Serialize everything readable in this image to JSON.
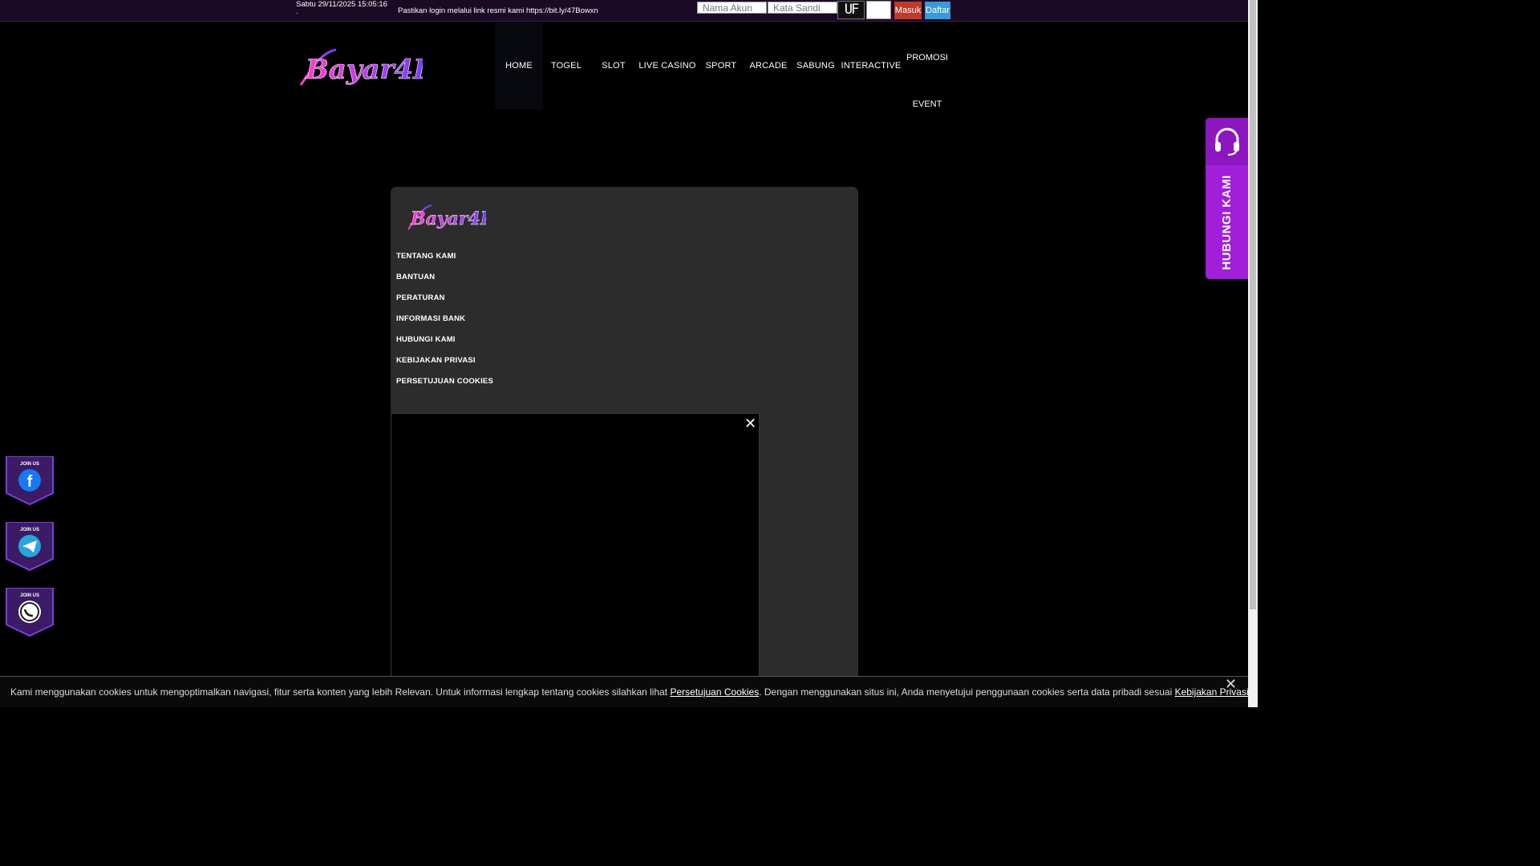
{
  "topbar": {
    "datetime": "Sabtu 29/11/2025 15:05:16",
    "datetime_icon": "·",
    "notice": "Pastikan login melalui link resmi kami https://bit.ly/47Bowxn",
    "username_placeholder": "Nama Akun",
    "password_placeholder": "Kata Sandi",
    "captcha_text": "UF",
    "login_label": "Masuk",
    "register_label": "Daftar"
  },
  "brand": {
    "logo_text": "Bayar4D",
    "logo_colors": [
      "#ff3dd0",
      "#6a3dff"
    ]
  },
  "nav": {
    "items": [
      "HOME",
      "TOGEL",
      "SLOT",
      "LIVE CASINO",
      "SPORT",
      "ARCADE",
      "SABUNG",
      "INTERACTIVE"
    ],
    "promosi": "PROMOSI",
    "event": "EVENT"
  },
  "contact": {
    "label": "HUBUNGI KAMI",
    "icon": "headset-icon"
  },
  "modal": {
    "links": [
      "TENTANG KAMI",
      "BANTUAN",
      "PERATURAN",
      "INFORMASI BANK",
      "HUBUNGI KAMI",
      "KEBIJAKAN PRIVASI",
      "PERSETUJUAN COOKIES"
    ],
    "video_close": "✕"
  },
  "social": {
    "badge_text": "JOIN US",
    "items": [
      {
        "name": "facebook",
        "icon": "facebook-icon",
        "color": "#1877f2"
      },
      {
        "name": "telegram",
        "icon": "telegram-icon",
        "color": "#2aa3df"
      },
      {
        "name": "whatsapp",
        "icon": "whatsapp-icon",
        "color": "#25d366"
      }
    ]
  },
  "cookie": {
    "text_before": "Kami menggunakan cookies untuk mengoptimalkan navigasi, fitur serta konten yang lebih Relevan. Untuk informasi lengkap tentang cookies silahkan lihat ",
    "link1": "Persetujuan Cookies",
    "text_middle": ". Dengan menggunakan situs ini, Anda menyetujui penggunaan cookies serta data pribadi sesuai ",
    "link2": "Kebijakan Privasi",
    "text_after": ".",
    "close": "✕"
  },
  "colors": {
    "accent_purple": "#a11fd8",
    "login_red": "#c0392b",
    "register_blue": "#3a9ad9",
    "modal_bg": "#2c2c2c"
  }
}
